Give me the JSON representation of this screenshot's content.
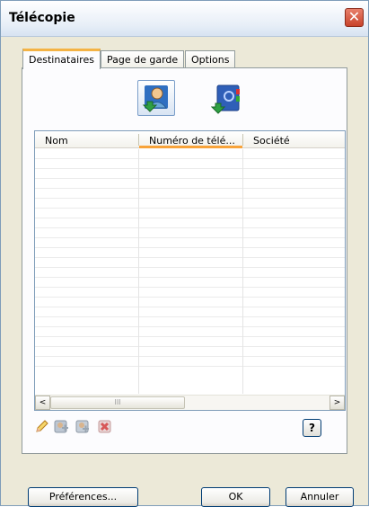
{
  "window": {
    "title": "Télécopie",
    "close_symbol": "✕"
  },
  "tabs": [
    {
      "label": "Destinataires",
      "active": true
    },
    {
      "label": "Page de garde",
      "active": false
    },
    {
      "label": "Options",
      "active": false
    }
  ],
  "icons": {
    "add_recipient": "add-recipient-from-contact-icon",
    "address_book": "address-book-icon"
  },
  "recipients": {
    "columns": [
      "Nom",
      "Numéro de télé...",
      "Société"
    ],
    "sorted_column": "Numéro de télé...",
    "rows": [],
    "scroll_left": "<",
    "scroll_right": ">",
    "thumb_grip": "III"
  },
  "row_tools": [
    "edit-icon",
    "add-contact-icon",
    "copy-contact-icon",
    "delete-icon"
  ],
  "help": {
    "label": "?"
  },
  "buttons": {
    "preferences": "Préférences...",
    "ok": "OK",
    "cancel": "Annuler"
  },
  "colors": {
    "tab_accent": "#f4b345",
    "sort_accent": "#f8a33a",
    "close_red": "#c8432b"
  }
}
